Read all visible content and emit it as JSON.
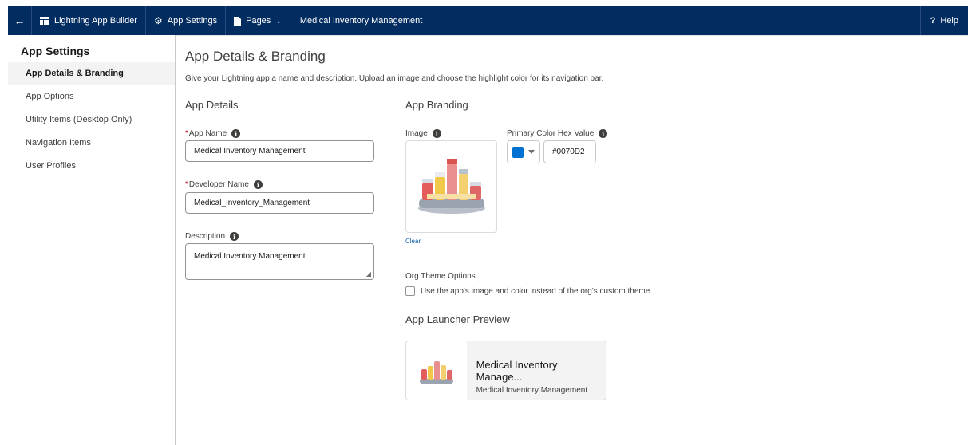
{
  "topbar": {
    "back_icon": "arrow-left-icon",
    "builder_label": "Lightning App Builder",
    "settings_label": "App Settings",
    "pages_label": "Pages",
    "app_title": "Medical Inventory Management",
    "help_label": "Help",
    "background_color": "#032d60"
  },
  "sidebar": {
    "title": "App Settings",
    "items": [
      {
        "label": "App Details & Branding",
        "active": true
      },
      {
        "label": "App Options"
      },
      {
        "label": "Utility Items (Desktop Only)"
      },
      {
        "label": "Navigation Items"
      },
      {
        "label": "User Profiles"
      }
    ]
  },
  "main": {
    "title": "App Details & Branding",
    "description": "Give your Lightning app a name and description. Upload an image and choose the highlight color for its navigation bar.",
    "app_details": {
      "heading": "App Details",
      "app_name_label": "App Name",
      "app_name_value": "Medical Inventory Management",
      "developer_name_label": "Developer Name",
      "developer_name_value": "Medical_Inventory_Management",
      "description_label": "Description",
      "description_value": "Medical Inventory Management"
    },
    "app_branding": {
      "heading": "App Branding",
      "image_label": "Image",
      "clear_label": "Clear",
      "color_label": "Primary Color Hex Value",
      "color_value": "#0070D2",
      "swatch_color": "#0070d2",
      "org_theme_label": "Org Theme Options",
      "org_theme_checkbox_label": "Use the app's image and color instead of the org's custom theme",
      "org_theme_checked": false
    },
    "launcher_preview": {
      "heading": "App Launcher Preview",
      "title": "Medical Inventory Manage...",
      "subtitle": "Medical Inventory Management"
    }
  }
}
